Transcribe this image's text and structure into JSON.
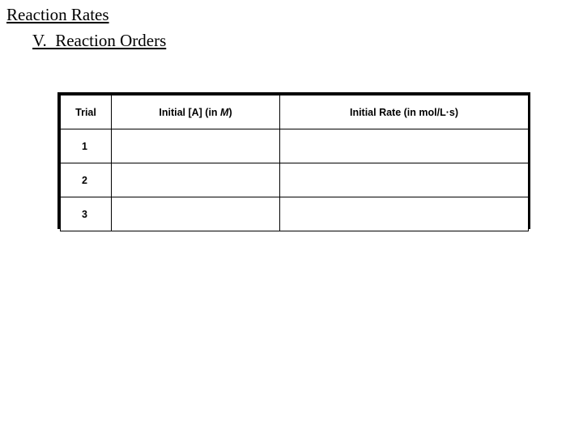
{
  "slide": {
    "title": "Reaction Rates",
    "subtitle": "V.  Reaction Orders"
  },
  "table": {
    "headers": {
      "trial": "Trial",
      "concentration_prefix": "Initial [A] (in ",
      "concentration_unit": "M",
      "concentration_suffix": ")",
      "concentration_full": "Initial [A] (in M)",
      "rate": "Initial Rate (in mol/L·s)"
    },
    "rows": [
      {
        "trial": "1",
        "concentration": "",
        "rate": ""
      },
      {
        "trial": "2",
        "concentration": "",
        "rate": ""
      },
      {
        "trial": "3",
        "concentration": "",
        "rate": ""
      }
    ]
  },
  "colors": {
    "background": "#ffffff",
    "text": "#000000",
    "border": "#000000"
  }
}
